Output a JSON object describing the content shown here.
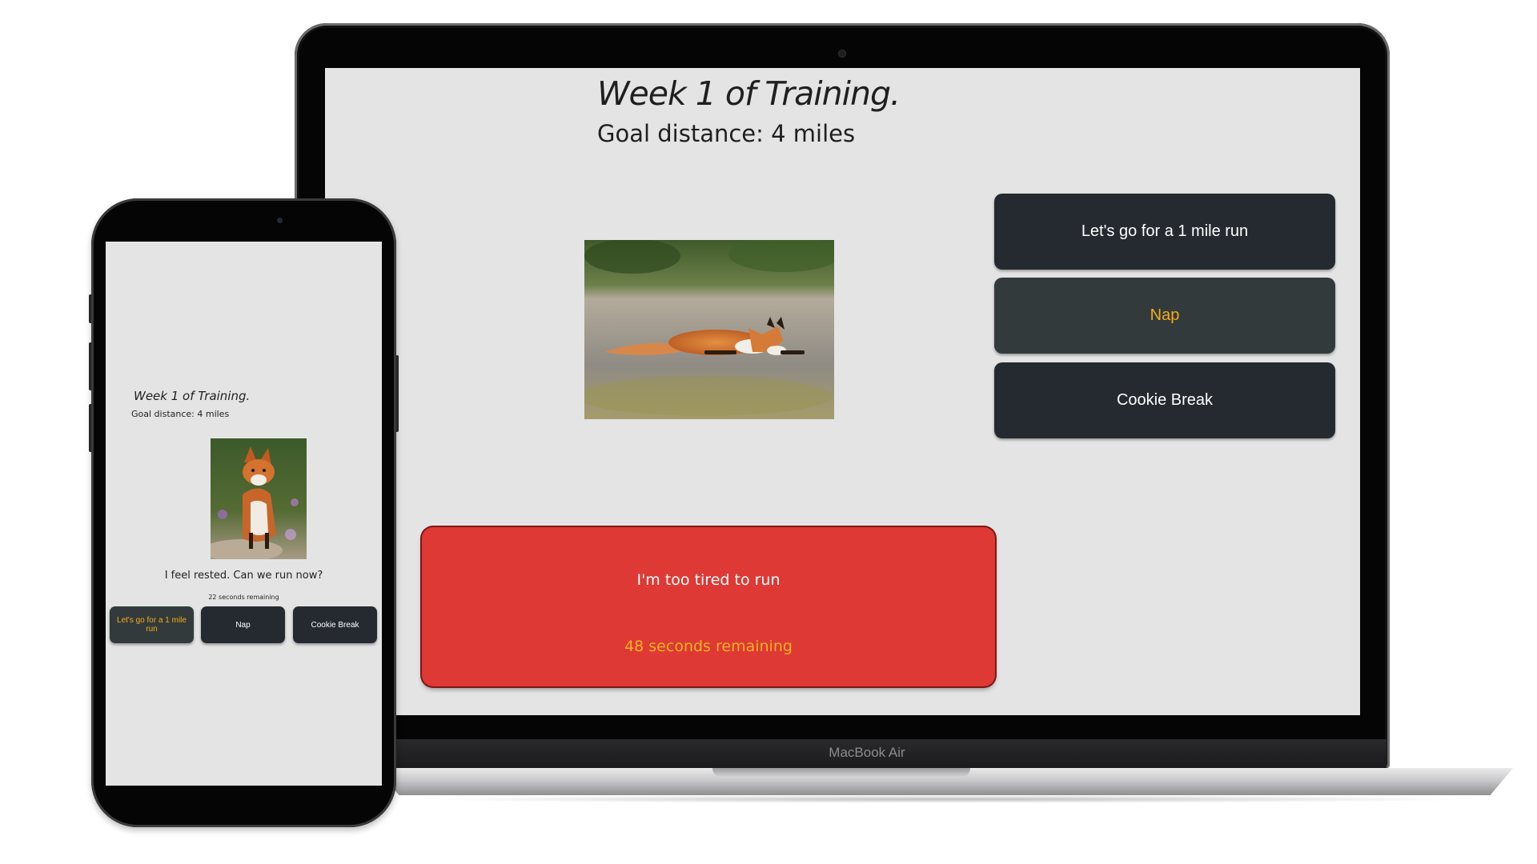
{
  "laptop": {
    "brand": "MacBook Air",
    "title": "Week 1 of Training.",
    "goal": "Goal distance: 4 miles",
    "photo_icon": "sleeping-fox-photo",
    "buttons": {
      "run": "Let's go for a 1 mile run",
      "nap": "Nap",
      "cookie": "Cookie Break"
    },
    "card": {
      "message": "I'm too tired to run",
      "timer": "48 seconds remaining",
      "color": "#de3934"
    }
  },
  "phone": {
    "title": "Week 1 of Training.",
    "goal": "Goal distance: 4 miles",
    "photo_icon": "sitting-fox-photo",
    "message": "I feel rested. Can we run now?",
    "timer": "22 seconds remaining",
    "buttons": {
      "run": "Let's go for a 1 mile run",
      "nap": "Nap",
      "cookie": "Cookie Break"
    }
  },
  "colors": {
    "screen_bg": "#e4e4e4",
    "button_dark": "#252a31",
    "button_highlight": "#333a3b",
    "accent_orange": "#f2ac1c"
  }
}
